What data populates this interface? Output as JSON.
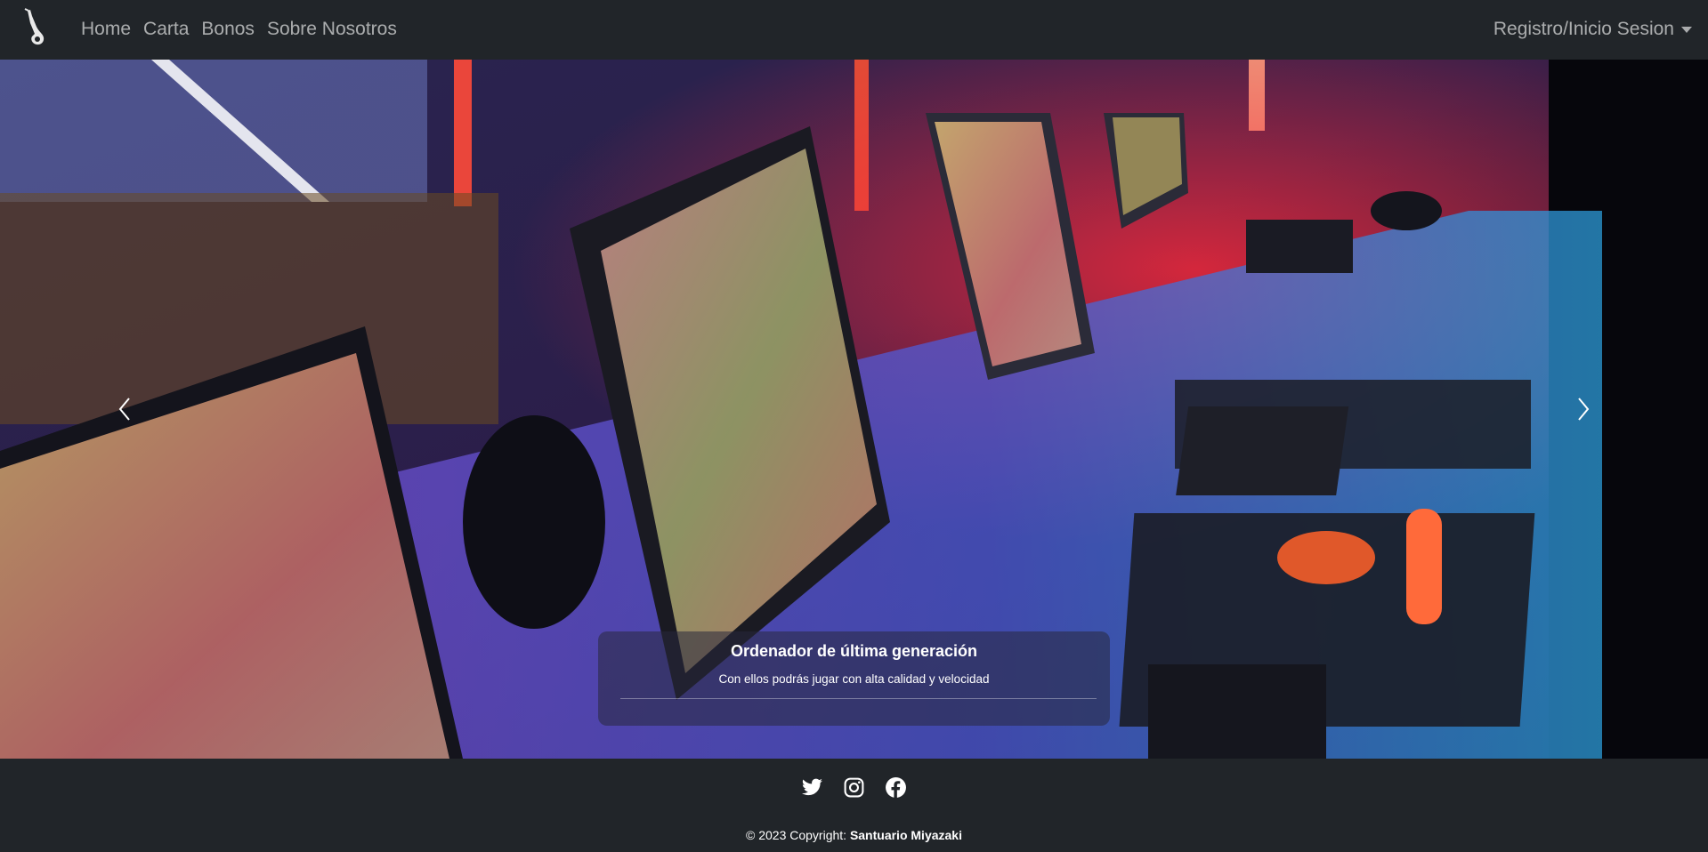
{
  "navbar": {
    "brand_icon": "saxophone-logo-icon",
    "links": [
      "Home",
      "Carta",
      "Bonos",
      "Sobre Nosotros"
    ],
    "account_dropdown": "Registro/Inicio Sesion"
  },
  "carousel": {
    "slide_image": "gaming-pc-room-photo",
    "caption_title": "Ordenador de última generación",
    "caption_text": "Con ellos podrás jugar con alta calidad y velocidad",
    "prev_icon": "chevron-left-icon",
    "next_icon": "chevron-right-icon"
  },
  "footer": {
    "social_icons": [
      "twitter-icon",
      "instagram-icon",
      "facebook-icon"
    ],
    "copyright_prefix": "© 2023 Copyright:",
    "copyright_owner": "Santuario Miyazaki"
  },
  "colors": {
    "navbar_bg": "#212529",
    "link": "rgba(255,255,255,0.62)",
    "accent_red": "#ff3b30",
    "accent_blue": "#3aa0ff"
  }
}
